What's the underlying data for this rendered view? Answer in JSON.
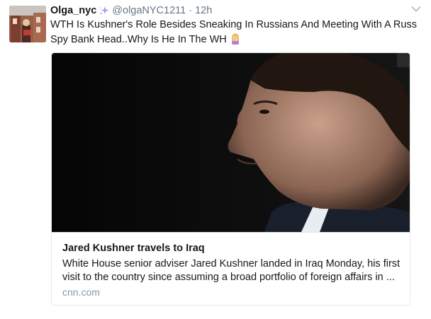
{
  "tweet": {
    "display_name": "Olga_nyc",
    "handle": "@olgaNYC1211",
    "separator": "·",
    "time": "12h",
    "text_line1": "WTH Is Kushner's Role Besides Sneaking In Russians And Meeting With A Russ",
    "text_line2": "Spy Bank Head..Why Is He In The WH",
    "name_emoji_icon": "sparkles-icon",
    "text_emoji_icon": "woman-facepalming-icon"
  },
  "card": {
    "image_icon": "news-photo",
    "title": "Jared Kushner travels to Iraq",
    "description_line1": "White House senior adviser Jared Kushner landed in Iraq Monday, his first",
    "description_line2": "visit to the country since assuming a broad portfolio of foreign affairs in ...",
    "domain": "cnn.com"
  },
  "colors": {
    "secondary_text": "#657786",
    "card_border": "#e1e8ed",
    "domain_text": "#8899a6",
    "sparkle": "#ab8ef2"
  }
}
